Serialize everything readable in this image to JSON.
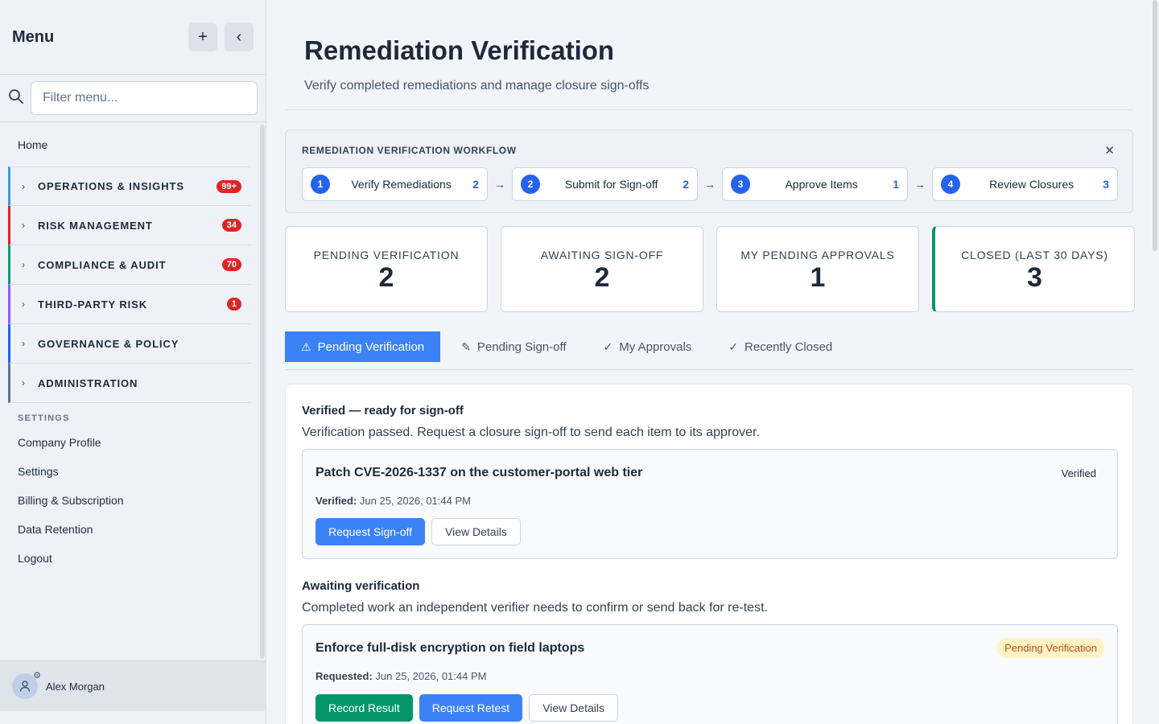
{
  "sidebar": {
    "title": "Menu",
    "add_icon": "+",
    "collapse_icon": "‹",
    "search_placeholder": "Filter menu...",
    "home": "Home",
    "groups": [
      {
        "label": "OPERATIONS & INSIGHTS",
        "badge": "99+",
        "color": "#3b9bd6"
      },
      {
        "label": "RISK MANAGEMENT",
        "badge": "34",
        "color": "#dc2626"
      },
      {
        "label": "COMPLIANCE & AUDIT",
        "badge": "70",
        "color": "#0f9d6e"
      },
      {
        "label": "THIRD-PARTY RISK",
        "badge": "1",
        "color": "#8b5cf6"
      },
      {
        "label": "GOVERNANCE & POLICY",
        "badge": "",
        "color": "#2563eb"
      },
      {
        "label": "ADMINISTRATION",
        "badge": "",
        "color": "#64748b"
      }
    ],
    "settings_heading": "SETTINGS",
    "settings_items": [
      "Company Profile",
      "Settings",
      "Billing & Subscription",
      "Data Retention",
      "Logout"
    ],
    "user_name": "Alex Morgan"
  },
  "header": {
    "title": "Remediation Verification",
    "subtitle": "Verify completed remediations and manage closure sign-offs"
  },
  "workflow": {
    "title": "REMEDIATION VERIFICATION WORKFLOW",
    "close_icon": "✕",
    "steps": [
      {
        "num": "1",
        "label": "Verify Remediations",
        "count": "2"
      },
      {
        "num": "2",
        "label": "Submit for Sign-off",
        "count": "2"
      },
      {
        "num": "3",
        "label": "Approve Items",
        "count": "1"
      },
      {
        "num": "4",
        "label": "Review Closures",
        "count": "3"
      }
    ],
    "arrow": "→"
  },
  "stats": [
    {
      "label": "PENDING VERIFICATION",
      "value": "2"
    },
    {
      "label": "AWAITING SIGN-OFF",
      "value": "2"
    },
    {
      "label": "MY PENDING APPROVALS",
      "value": "1"
    },
    {
      "label": "CLOSED (LAST 30 DAYS)",
      "value": "3"
    }
  ],
  "tabs": [
    {
      "icon": "⚠",
      "label": "Pending Verification"
    },
    {
      "icon": "✎",
      "label": "Pending Sign-off"
    },
    {
      "icon": "✓",
      "label": "My Approvals"
    },
    {
      "icon": "✓",
      "label": "Recently Closed"
    }
  ],
  "sections": {
    "verified": {
      "heading": "Verified — ready for sign-off",
      "description": "Verification passed. Request a closure sign-off to send each item to its approver.",
      "card": {
        "title": "Patch CVE-2026-1337 on the customer-portal web tier",
        "status": "Verified",
        "meta_label": "Verified:",
        "meta_value": "Jun 25, 2026, 01:44 PM",
        "btn_primary": "Request Sign-off",
        "btn_secondary": "View Details"
      }
    },
    "awaiting": {
      "heading": "Awaiting verification",
      "description": "Completed work an independent verifier needs to confirm or send back for re-test.",
      "card": {
        "title": "Enforce full-disk encryption on field laptops",
        "status": "Pending Verification",
        "meta_label": "Requested:",
        "meta_value": "Jun 25, 2026, 01:44 PM",
        "btn_record": "Record Result",
        "btn_retest": "Request Retest",
        "btn_details": "View Details"
      }
    }
  }
}
